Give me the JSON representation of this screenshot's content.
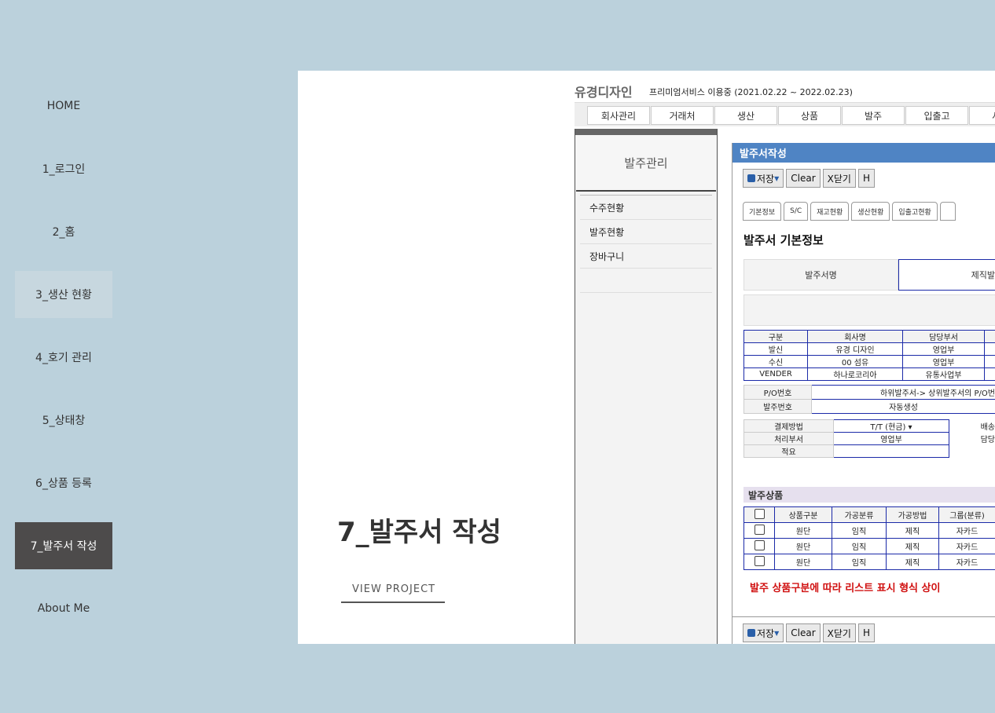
{
  "nav": {
    "items": [
      {
        "label": "HOME"
      },
      {
        "label": "1_로그인"
      },
      {
        "label": "2_홈"
      },
      {
        "label": "3_생산 현황"
      },
      {
        "label": "4_호기 관리"
      },
      {
        "label": "5_상태창"
      },
      {
        "label": "6_상품 등록"
      },
      {
        "label": "7_발주서 작성"
      },
      {
        "label": "About Me"
      }
    ]
  },
  "project": {
    "title": "7_발주서 작성",
    "button": "VIEW PROJECT"
  },
  "shot": {
    "brand": "유경디자인",
    "subscription": "프리미엄서비스 이용중 (2021.02.22 ~ 2022.02.23)",
    "menu": [
      "회사관리",
      "거래처",
      "생산",
      "상품",
      "발주",
      "입출고",
      "서류"
    ],
    "sidebar": {
      "title": "발주관리",
      "items": [
        "수주현황",
        "발주현황",
        "장바구니"
      ]
    },
    "window_title": "발주서작성",
    "toolbar": {
      "save": "저장",
      "clear": "Clear",
      "close": "X닫기",
      "h": "H"
    },
    "tabs": [
      "기본정보",
      "S/C",
      "재고현황",
      "생산현황",
      "입출고현황"
    ],
    "section_title": "발주서 기본정보",
    "order_name_label": "발주서명",
    "order_name_value": "제직발",
    "parties": {
      "headers": [
        "구분",
        "회사명",
        "담당부서"
      ],
      "rows": [
        [
          "발신",
          "유경 디자인",
          "영업부"
        ],
        [
          "수신",
          "00 섬유",
          "영업부"
        ],
        [
          "VENDER",
          "하나로코리아",
          "유통사업부"
        ]
      ]
    },
    "po": {
      "po_label": "P/O번호",
      "po_value": "하위발주서-> 상위발주서의 P/O번",
      "order_no_label": "발주번호",
      "order_no_value": "자동생성"
    },
    "payment": {
      "pay_label": "결제방법",
      "pay_value": "T/T (현금) ▾",
      "ship_label": "배송",
      "dept_label": "처리부서",
      "dept_value": "영업부",
      "manager_label": "담당",
      "note_label": "적요"
    },
    "products": {
      "title": "발주상품",
      "headers": [
        "상품구분",
        "가공분류",
        "가공방법",
        "그룹(분류)"
      ],
      "rows": [
        [
          "원단",
          "임직",
          "제직",
          "자카드"
        ],
        [
          "원단",
          "임직",
          "제직",
          "자카드"
        ],
        [
          "원단",
          "임직",
          "제직",
          "자카드"
        ]
      ]
    },
    "note": "발주 상품구분에 따라 리스트 표시 형식 상이"
  }
}
